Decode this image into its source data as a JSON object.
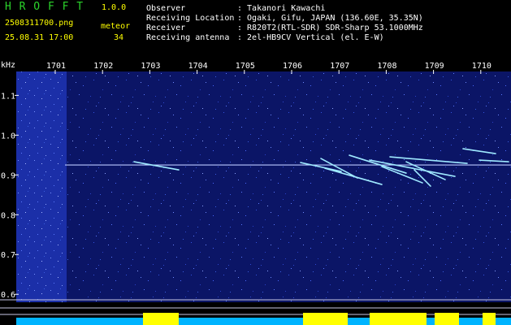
{
  "header": {
    "app_name": "H R O F F T",
    "version": "1.0.0",
    "filename": "2508311700.png",
    "datetime": "25.08.31 17:00",
    "meteor_label": "meteor",
    "meteor_count": "34",
    "info": [
      {
        "key": "Observer",
        "value": ": Takanori Kawachi"
      },
      {
        "key": "Receiving Location",
        "value": ": Ogaki, Gifu, JAPAN (136.60E, 35.35N)"
      },
      {
        "key": "Receiver",
        "value": ": R820T2(RTL-SDR) SDR-Sharp 53.1000MHz"
      },
      {
        "key": "Receiving antenna",
        "value": ": 2el-HB9CV Vertical (el. E-W)"
      }
    ]
  },
  "chart_data": {
    "type": "heatmap",
    "ylabel": "kHz",
    "x_ticks": [
      "1701",
      "1702",
      "1703",
      "1704",
      "1705",
      "1706",
      "1707",
      "1708",
      "1709",
      "1710"
    ],
    "y_ticks": [
      "1.1",
      "1.0",
      "0.9",
      "0.8",
      "0.7",
      "0.6"
    ],
    "ylim": [
      0.58,
      1.16
    ],
    "carrier_khz": 0.925,
    "colors": {
      "background": "#000000",
      "noise": "#1a2ea8",
      "signal": "#ffffff",
      "baseline": "#00b4ff",
      "activity": "#ffff00"
    }
  }
}
